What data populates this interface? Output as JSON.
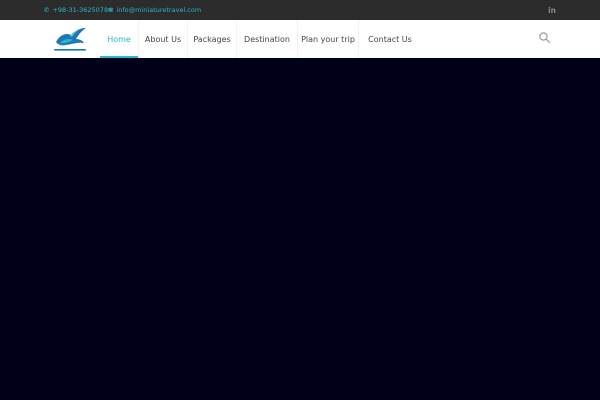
{
  "topbar": {
    "phone": "+98-31-36250784",
    "email": "info@miniaturetravel.com",
    "social": "in",
    "icons": {
      "phone": "phone-icon",
      "email": "envelope-icon",
      "social": "linkedin-icon"
    }
  },
  "nav": {
    "items": [
      {
        "label": "Home",
        "active": true
      },
      {
        "label": "About Us",
        "active": false
      },
      {
        "label": "Packages",
        "active": false
      },
      {
        "label": "Destination",
        "active": false
      },
      {
        "label": "Plan your trip",
        "active": false
      },
      {
        "label": "Contact Us",
        "active": false
      }
    ],
    "search_icon": "search-icon"
  },
  "colors": {
    "accent": "#2bb8c7",
    "topbar_bg": "#2c2c2c",
    "nav_bg": "#ffffff",
    "hero_bg": "#000018",
    "nav_text": "#444444"
  }
}
